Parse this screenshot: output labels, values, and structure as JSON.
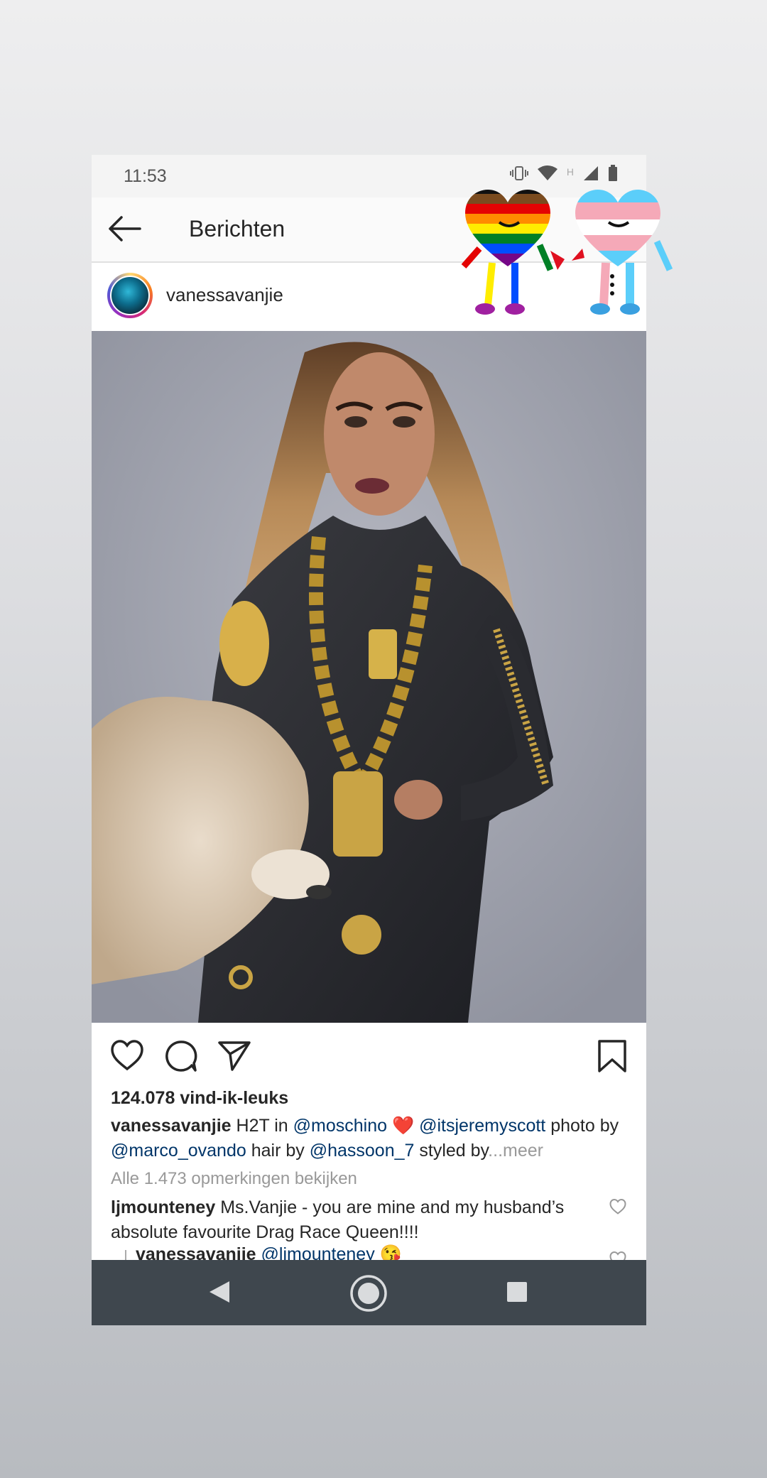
{
  "status_bar": {
    "time": "11:53",
    "network_label": "H"
  },
  "app_bar": {
    "title": "Berichten"
  },
  "post": {
    "username": "vanessavanjie",
    "likes": "124.078 vind-ik-leuks",
    "caption": {
      "author": "vanessavanjie",
      "t1": " H2T in ",
      "m1": "@moschino",
      "heart": " ❤️ ",
      "m2": "@itsjeremyscott",
      "t2": " photo by ",
      "m3": "@marco_ovando",
      "t3": " hair by ",
      "m4": "@hassoon_7",
      "t4": " styled by",
      "more": "...meer"
    },
    "view_all_comments": "Alle 1.473 opmerkingen bekijken",
    "comments": [
      {
        "author": "ljmounteney",
        "text": " Ms.Vanjie - you are mine and my husband’s absolute favourite Drag Race Queen!!!!"
      }
    ],
    "reply": {
      "author": "vanessavanjie",
      "mention": " @ljmounteney",
      "emoji": " 😘"
    }
  },
  "colors": {
    "mention": "#003569",
    "navbar": "#3f474e",
    "heart": "#e0245e"
  },
  "icons": [
    "back-arrow-icon",
    "heart-icon",
    "comment-icon",
    "share-icon",
    "bookmark-icon",
    "nav-back-icon",
    "nav-home-icon",
    "nav-recents-icon"
  ]
}
